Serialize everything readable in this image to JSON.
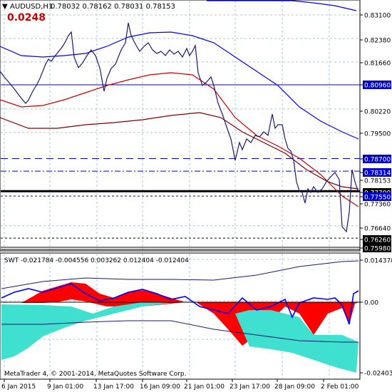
{
  "header": {
    "arrow": "▼",
    "symbol": "AUDUSD,H1",
    "ohlc": "0.78032 0.78162 0.78031 0.78153",
    "spread_value": "0.0248"
  },
  "main_axis": {
    "ticks": [
      "0.83100",
      "0.82380",
      "0.81660",
      "0.80960",
      "0.80220",
      "0.79500",
      "0.78700",
      "0.78314",
      "0.78153",
      "0.77700",
      "0.77550",
      "0.77360",
      "0.76640",
      "0.76260",
      "0.75980"
    ],
    "boxed": {
      "0.80960": {
        "bg": "#0000c8",
        "fg": "#ffffff"
      },
      "0.78700": {
        "bg": "#0000c8",
        "fg": "#ffffff"
      },
      "0.78314": {
        "bg": "#0000c8",
        "fg": "#ffffff"
      },
      "0.77700": {
        "bg": "#000000",
        "fg": "#ffffff"
      },
      "0.77550": {
        "bg": "#0000c8",
        "fg": "#ffffff"
      },
      "0.76260": {
        "bg": "#000000",
        "fg": "#ffffff"
      },
      "0.75980": {
        "bg": "#000000",
        "fg": "#ffffff"
      }
    }
  },
  "indicator": {
    "label": "SWT -0.021784 -0.004556 0.003262 0.012404 -0.012404",
    "ticks": [
      "0.014378",
      "0.00",
      "-0.024032"
    ]
  },
  "copyright": "MetaTrader 4, © 2001-2014, MetaQuotes Software Corp.",
  "time_axis": [
    "6 Jan 2015",
    "9 Jan 01:00",
    "13 Jan 17:00",
    "16 Jan 09:00",
    "21 Jan 01:00",
    "23 Jan 17:00",
    "28 Jan 09:00",
    "2 Feb 01:00"
  ],
  "colors": {
    "price": "#1a1a6e",
    "ma_blue": "#0000ff",
    "ma_red": "#cc0000",
    "ma_dark": "#800000",
    "fill_red": "#ff0000",
    "fill_turq": "#40e0d0",
    "grid": "#a8c6d8"
  }
}
